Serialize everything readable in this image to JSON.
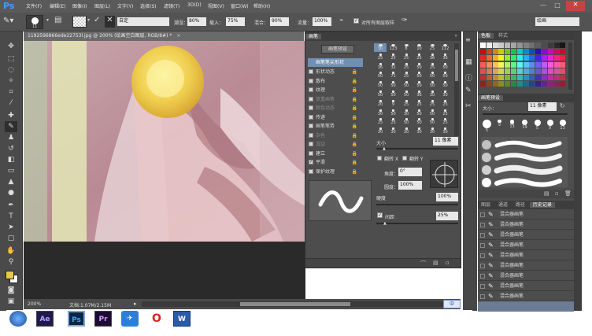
{
  "app": {
    "logo": "Ps"
  },
  "menu": [
    "文件(F)",
    "编辑(E)",
    "图像(I)",
    "图层(L)",
    "文字(Y)",
    "选择(S)",
    "滤镜(T)",
    "3D(D)",
    "视图(V)",
    "窗口(W)",
    "帮助(H)"
  ],
  "window_controls": {
    "minimize": "—",
    "maximize": "□",
    "close": "✕"
  },
  "options": {
    "brush_size": "11",
    "mode_value": "自定",
    "wetness_label": "潮湿：",
    "wetness_value": "80%",
    "load_label": "载入：",
    "load_value": "75%",
    "mix_label": "混合：",
    "mix_value": "90%",
    "flow_label": "流量：",
    "flow_value": "100%",
    "sample_all_label": "对所有图层取样",
    "workspace_value": "绘画"
  },
  "document": {
    "tab_title": "1192596866ede22753l.jpg @ 200% (绘画空白图层, RGB/8#) *",
    "zoom": "200%",
    "doc_info": "文档:1.07M/2.15M"
  },
  "brush_panel": {
    "tabs": [
      "画笔"
    ],
    "preset_button": "画笔预设",
    "selected_item": "画笔笔尖形状",
    "items": [
      {
        "label": "形状动态",
        "checked": false,
        "dim": false
      },
      {
        "label": "散布",
        "checked": false,
        "dim": false
      },
      {
        "label": "纹理",
        "checked": false,
        "dim": false
      },
      {
        "label": "双重画笔",
        "checked": false,
        "dim": true
      },
      {
        "label": "颜色动态",
        "checked": false,
        "dim": true
      },
      {
        "label": "传递",
        "checked": false,
        "dim": false
      },
      {
        "label": "画笔笔势",
        "checked": false,
        "dim": false
      },
      {
        "label": "杂色",
        "checked": false,
        "dim": true
      },
      {
        "label": "湿边",
        "checked": false,
        "dim": true
      },
      {
        "label": "建立",
        "checked": false,
        "dim": false
      },
      {
        "label": "平滑",
        "checked": true,
        "dim": false
      },
      {
        "label": "保护纹理",
        "checked": false,
        "dim": false
      }
    ],
    "tip_sizes": [
      [
        "30",
        "123",
        "8",
        "10",
        "25",
        "112"
      ],
      [
        "25",
        "25",
        "25",
        "25",
        "36",
        "36"
      ],
      [
        "36",
        "32",
        "25",
        "50",
        "25",
        "50"
      ],
      [
        "50",
        "71",
        "25",
        "50",
        "50",
        "50"
      ],
      [
        "50",
        "50",
        "50",
        "50",
        "50",
        "50"
      ],
      [
        "50",
        "50",
        "50",
        "36",
        "30",
        "30"
      ],
      [
        "20",
        "9",
        "25",
        "25",
        "25",
        "25"
      ],
      [
        "30",
        "50",
        "30",
        "50",
        "50",
        "25"
      ],
      [
        "25",
        "25",
        "50",
        "50",
        "50",
        "25"
      ],
      [
        "30",
        "30",
        "30",
        "30",
        "30",
        "30"
      ]
    ],
    "size_label": "大小",
    "size_value": "11 像素",
    "flip_x": "翻转 X",
    "flip_y": "翻转 Y",
    "angle_label": "角度：",
    "angle_value": "0°",
    "roundness_label": "圆度：",
    "roundness_value": "100%",
    "hardness_label": "硬度",
    "hardness_value": "100%",
    "spacing_label": "间距",
    "spacing_checked": true,
    "spacing_value": "25%"
  },
  "swatches_panel": {
    "tabs": [
      "色板",
      "样式"
    ]
  },
  "brush_presets_panel": {
    "tabs": [
      "画笔预设"
    ],
    "size_label": "大小：",
    "size_value": "11 像素",
    "dab_labels": [
      "5",
      "9",
      "13",
      "19",
      "5",
      "9",
      "13"
    ]
  },
  "history_panel": {
    "tabs": [
      "图层",
      "通道",
      "路径",
      "历史记录"
    ],
    "rows": [
      "混合器画笔",
      "混合器画笔",
      "混合器画笔",
      "混合器画笔",
      "混合器画笔",
      "混合器画笔",
      "混合器画笔",
      "混合器画笔",
      "混合器画笔"
    ]
  },
  "ime": {
    "label": "中"
  },
  "taskbar": {
    "items": [
      {
        "name": "start",
        "label": ""
      },
      {
        "name": "after-effects",
        "label": "Ae"
      },
      {
        "name": "photoshop",
        "label": "Ps"
      },
      {
        "name": "premiere",
        "label": "Pr"
      },
      {
        "name": "feiq",
        "label": "✈"
      },
      {
        "name": "opera",
        "label": "O"
      },
      {
        "name": "word",
        "label": "W"
      }
    ]
  },
  "colors": {
    "ps_blue": "#3aa3ff",
    "close_red": "#c74343",
    "foreground": "#e8c84a",
    "background": "#ffffff"
  }
}
